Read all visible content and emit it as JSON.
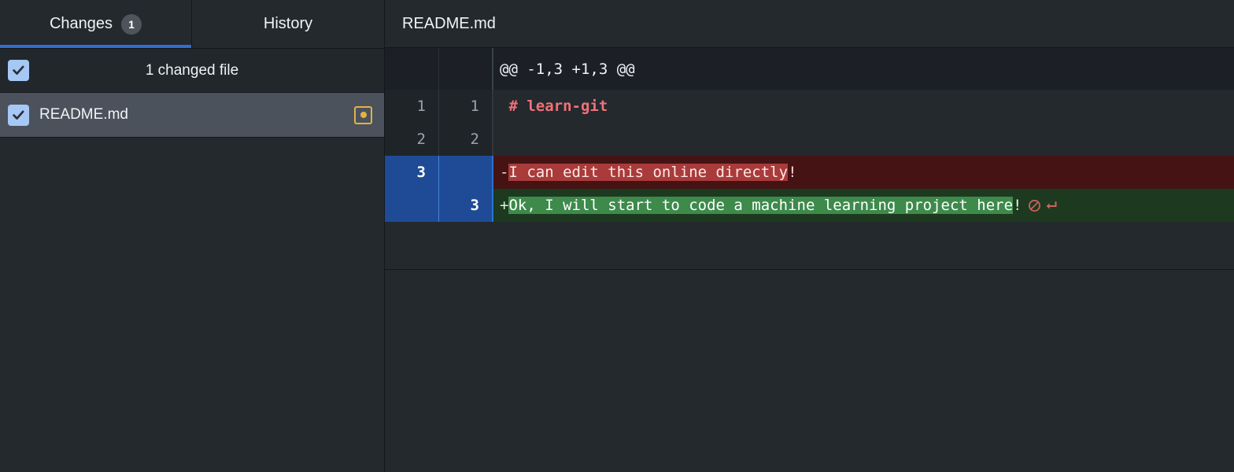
{
  "window": {
    "accent_blue": "#2f6fd0",
    "background": "#24292e"
  },
  "sidebar": {
    "tabs": [
      {
        "label": "Changes",
        "count": "1",
        "active": true
      },
      {
        "label": "History",
        "count": "",
        "active": false
      }
    ],
    "changes_header": {
      "label": "1 changed file",
      "checkbox_checked": true,
      "checkbox_icon": "checkmark-icon"
    },
    "files": [
      {
        "name": "README.md",
        "checkbox_checked": true,
        "checkbox_icon": "checkmark-icon",
        "status": "modified",
        "status_icon": "modified-dot-icon",
        "status_color": "#e3b341",
        "selected": true
      }
    ]
  },
  "diff": {
    "file_title": "README.md",
    "hunk_header": "@@ -1,3 +1,3 @@",
    "rows": [
      {
        "kind": "hunk",
        "old_line": "",
        "new_line": "",
        "prefix": "",
        "text": "@@ -1,3 +1,3 @@"
      },
      {
        "kind": "context",
        "old_line": "1",
        "new_line": "1",
        "prefix": " ",
        "text": "# learn-git",
        "syntax": "markdown-heading",
        "syntax_color": "#f07178"
      },
      {
        "kind": "context",
        "old_line": "2",
        "new_line": "2",
        "prefix": "",
        "text": ""
      },
      {
        "kind": "deleted",
        "old_line": "3",
        "new_line": "",
        "prefix": "-",
        "highlight_text": "I can edit this online directly",
        "tail_text": "!",
        "eol_markers": []
      },
      {
        "kind": "added",
        "old_line": "",
        "new_line": "3",
        "prefix": "+",
        "highlight_text": "Ok, I will start to code a machine learning project here",
        "tail_text": "!",
        "eol_markers": [
          "no-newline-icon",
          "carriage-return-icon"
        ],
        "eol_marker_color": "#d1635f"
      }
    ]
  }
}
